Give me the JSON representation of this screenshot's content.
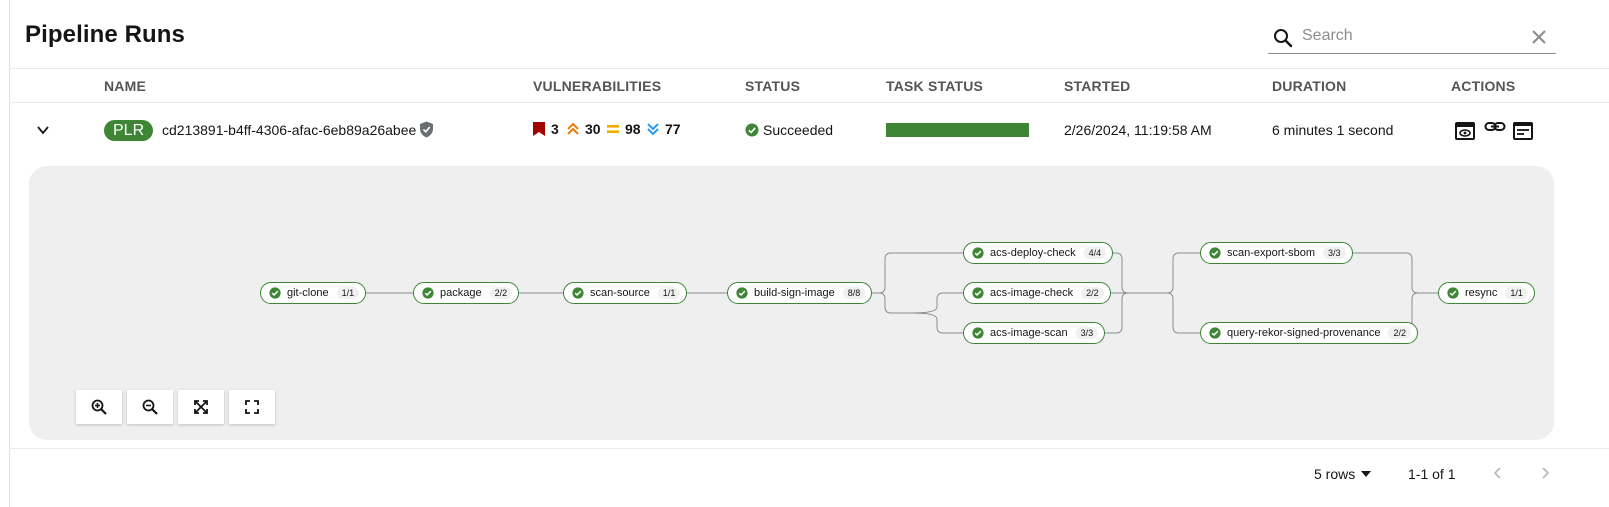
{
  "page": {
    "title": "Pipeline Runs"
  },
  "search": {
    "placeholder": "Search"
  },
  "table": {
    "headers": {
      "name": "NAME",
      "vulnerabilities": "VULNERABILITIES",
      "status": "STATUS",
      "task_status": "TASK STATUS",
      "started": "STARTED",
      "duration": "DURATION",
      "actions": "ACTIONS"
    },
    "row": {
      "badge": "PLR",
      "name": "cd213891-b4ff-4306-afac-6eb89a26abee",
      "vulnerabilities": {
        "critical": "3",
        "high": "30",
        "medium": "98",
        "low": "77"
      },
      "status": "Succeeded",
      "task_status_progress": 1.0,
      "started": "2/26/2024, 11:19:58 AM",
      "duration": "6 minutes 1 second",
      "actions": [
        "view-logs-icon",
        "link-icon",
        "summary-icon"
      ]
    }
  },
  "pipeline": {
    "tasks": [
      {
        "name": "git-clone",
        "count": "1/1"
      },
      {
        "name": "package",
        "count": "2/2"
      },
      {
        "name": "scan-source",
        "count": "1/1"
      },
      {
        "name": "build-sign-image",
        "count": "8/8"
      },
      {
        "name": "acs-deploy-check",
        "count": "4/4"
      },
      {
        "name": "acs-image-check",
        "count": "2/2"
      },
      {
        "name": "acs-image-scan",
        "count": "3/3"
      },
      {
        "name": "scan-export-sbom",
        "count": "3/3"
      },
      {
        "name": "query-rekor-signed-provenance",
        "count": "2/2"
      },
      {
        "name": "resync",
        "count": "1/1"
      }
    ],
    "controls": [
      "zoom-in-icon",
      "zoom-out-icon",
      "fit-icon",
      "fullscreen-icon"
    ]
  },
  "pagination": {
    "per_page": "5 rows",
    "range": "1-1 of 1"
  },
  "colors": {
    "success": "#3e8635",
    "critical": "#a30000",
    "high": "#ec7a08",
    "medium": "#f0ab00",
    "low": "#2b9af3"
  }
}
